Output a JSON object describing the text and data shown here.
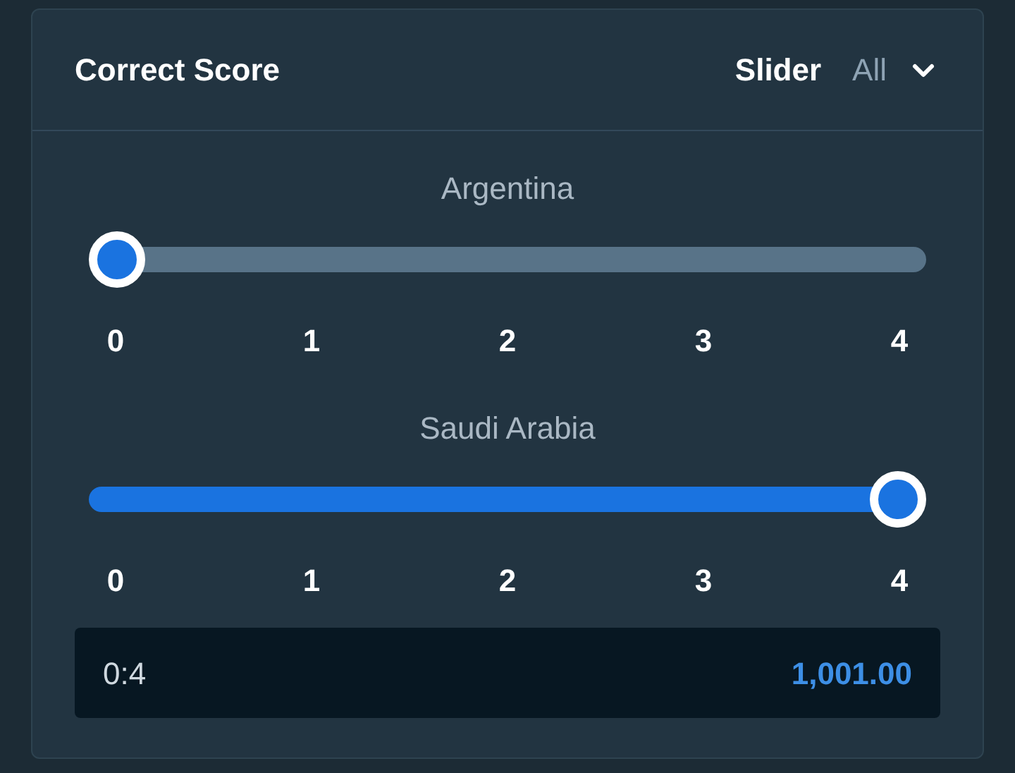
{
  "header": {
    "title": "Correct Score",
    "mode": "Slider",
    "filter": "All"
  },
  "sliders": [
    {
      "team": "Argentina",
      "level": 0,
      "ticks": [
        "0",
        "1",
        "2",
        "3",
        "4"
      ]
    },
    {
      "team": "Saudi Arabia",
      "level": 1,
      "ticks": [
        "0",
        "1",
        "2",
        "3",
        "4"
      ]
    }
  ],
  "result": {
    "score": "0:4",
    "odds": "1,001.00"
  }
}
